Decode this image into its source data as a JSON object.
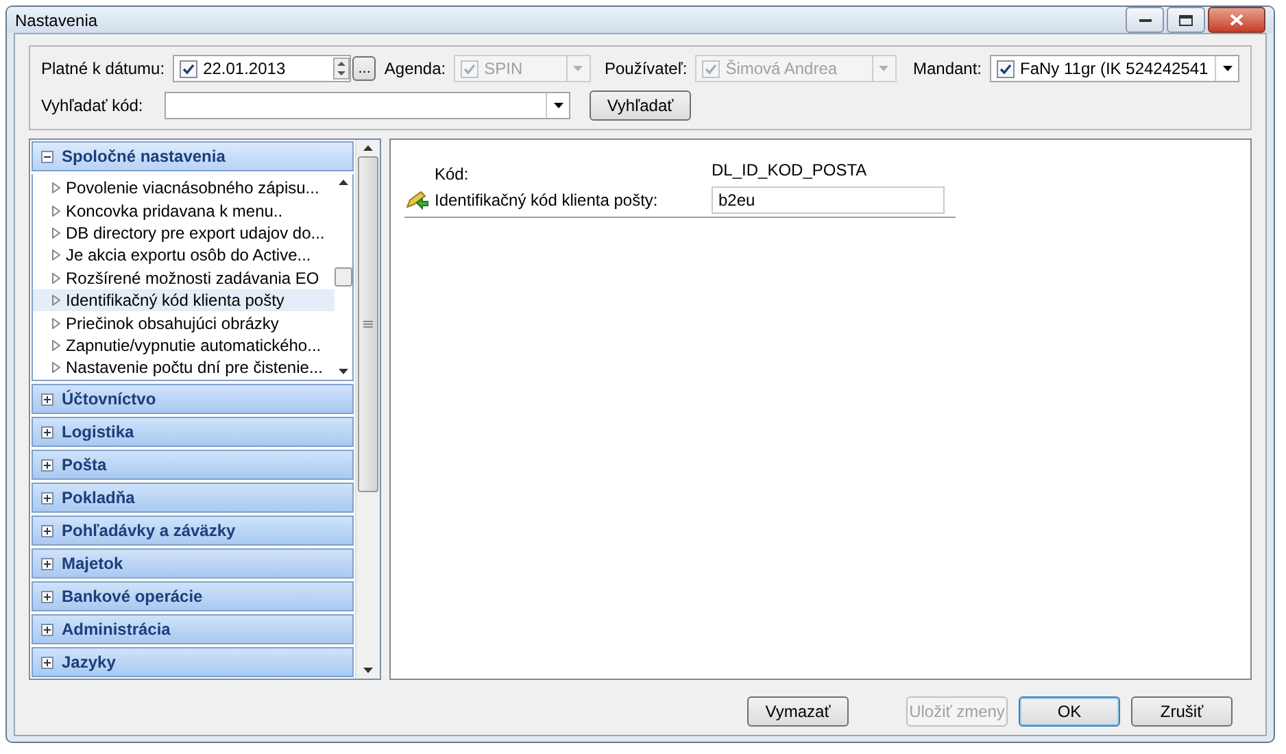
{
  "window": {
    "title": "Nastavenia"
  },
  "filters": {
    "date": {
      "label": "Platné k dátumu:",
      "checked": true,
      "value": "22.01.2013",
      "button": "..."
    },
    "agenda": {
      "label": "Agenda:",
      "checked": true,
      "disabled": true,
      "value": "SPIN"
    },
    "user": {
      "label": "Používateľ:",
      "checked": true,
      "disabled": true,
      "value": "Šimová Andrea"
    },
    "mandant": {
      "label": "Mandant:",
      "checked": true,
      "disabled": false,
      "value": "FaNy 11gr (IK 524242541"
    },
    "search": {
      "label": "Vyhľadať kód:",
      "button": "Vyhľadať"
    }
  },
  "sidebar": {
    "groups": [
      {
        "label": "Spoločné nastavenia",
        "expanded": true,
        "items": [
          {
            "label": "Povolenie viacnásobného zápisu...",
            "selected": false
          },
          {
            "label": "Koncovka pridavana k menu..",
            "selected": false
          },
          {
            "label": "DB directory pre export udajov do...",
            "selected": false
          },
          {
            "label": "Je akcia exportu osôb do Active...",
            "selected": false
          },
          {
            "label": "Rozšírené možnosti zadávania EO",
            "selected": false
          },
          {
            "label": "Identifikačný kód klienta pošty",
            "selected": true
          },
          {
            "label": "Priečinok obsahujúci obrázky",
            "selected": false
          },
          {
            "label": "Zapnutie/vypnutie  automatického...",
            "selected": false
          },
          {
            "label": "Nastavenie počtu dní pre čistenie...",
            "selected": false
          }
        ]
      },
      {
        "label": "Účtovníctvo",
        "expanded": false
      },
      {
        "label": "Logistika",
        "expanded": false
      },
      {
        "label": "Pošta",
        "expanded": false
      },
      {
        "label": "Pokladňa",
        "expanded": false
      },
      {
        "label": "Pohľadávky a záväzky",
        "expanded": false
      },
      {
        "label": "Majetok",
        "expanded": false
      },
      {
        "label": "Bankové operácie",
        "expanded": false
      },
      {
        "label": "Administrácia",
        "expanded": false
      },
      {
        "label": "Jazyky",
        "expanded": false
      }
    ]
  },
  "detail": {
    "code_label": "Kód:",
    "code_value": "DL_ID_KOD_POSTA",
    "field_label": "Identifikačný kód klienta pošty:",
    "field_value": "b2eu"
  },
  "buttons": [
    {
      "label": "Vymazať",
      "disabled": false,
      "default": false
    },
    {
      "label": "Uložiť zmeny",
      "disabled": true,
      "default": false
    },
    {
      "label": "OK",
      "disabled": false,
      "default": true
    },
    {
      "label": "Zrušiť",
      "disabled": false,
      "default": false
    }
  ]
}
